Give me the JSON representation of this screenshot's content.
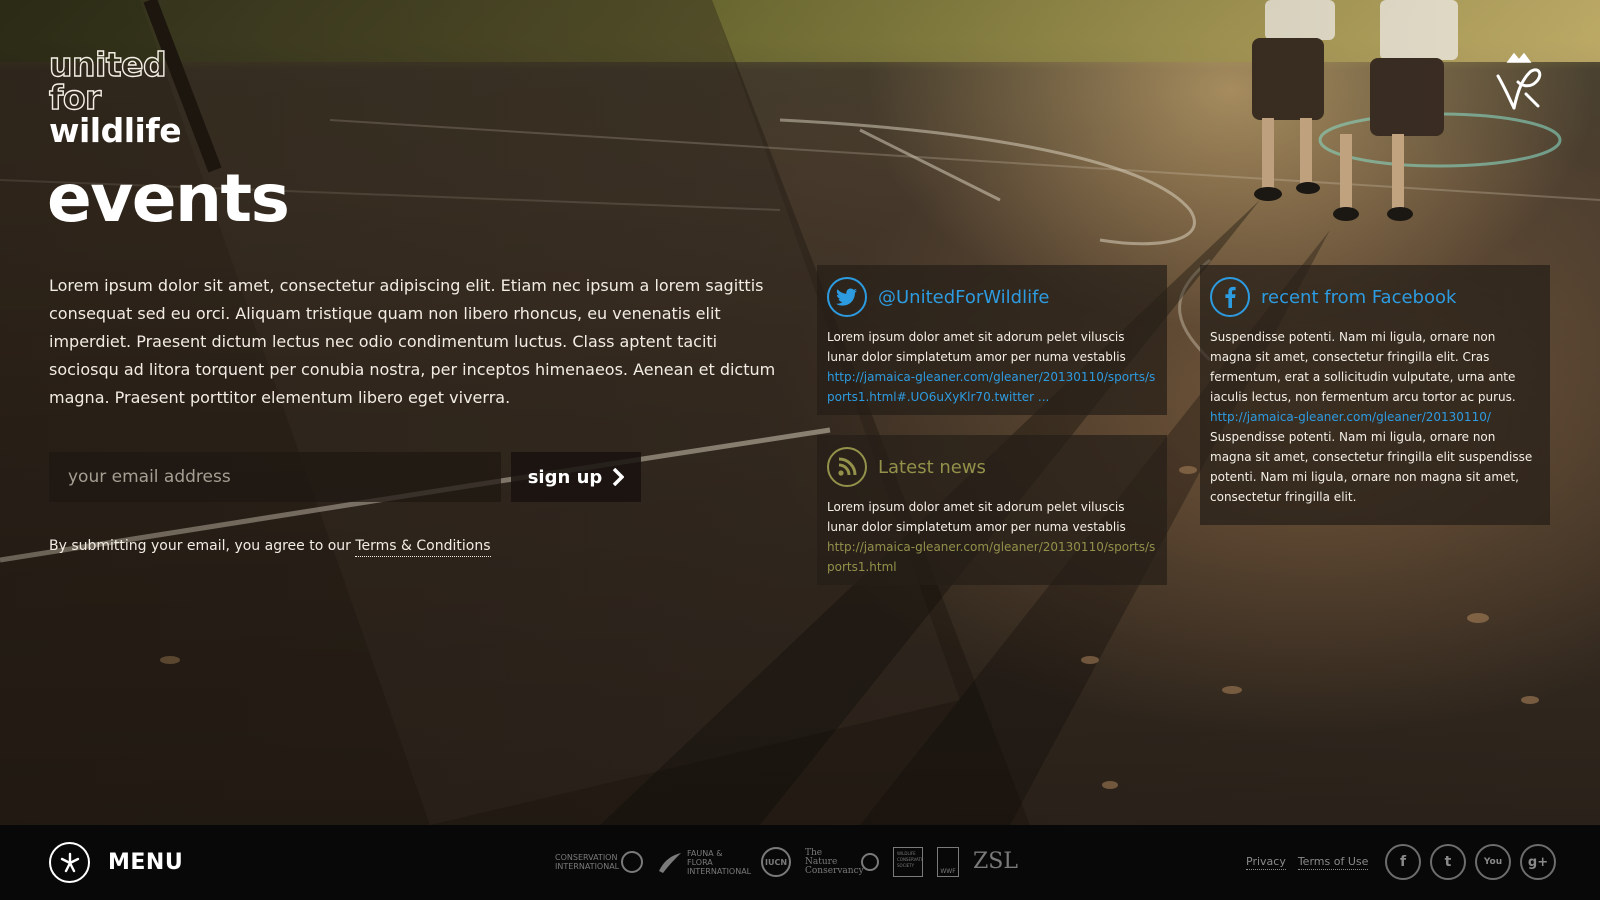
{
  "brand": {
    "line1": "united",
    "line2": "for",
    "line3": "wildlife"
  },
  "page": {
    "title": "events",
    "intro": "Lorem ipsum dolor sit amet, consectetur adipiscing elit. Etiam nec ipsum a lorem sagittis consequat sed eu orci. Aliquam tristique quam non libero rhoncus, eu venenatis elit imperdiet. Praesent dictum lectus nec odio condimentum luctus. Class aptent taciti sociosqu ad litora torquent per conubia nostra, per inceptos himenaeos. Aenean et dictum magna. Praesent porttitor elementum libero eget viverra."
  },
  "signup": {
    "placeholder": "your email address",
    "button_label": "sign up",
    "terms_prefix": "By submitting your email, you agree to our",
    "terms_link": "Terms & Conditions"
  },
  "twitter": {
    "title": "@UnitedForWildlife",
    "body": "Lorem ipsum dolor amet sit adorum pelet viluscis lunar dolor simplatetum amor per numa vestablis",
    "link": "http://jamaica-gleaner.com/gleaner/20130110/sports/sports1.html#.UO6uXyKlr70.twitter ..."
  },
  "news": {
    "title": "Latest news",
    "body": "Lorem ipsum dolor amet sit adorum pelet viluscis lunar dolor simplatetum amor per numa vestablis",
    "link": "http://jamaica-gleaner.com/gleaner/20130110/sports/sports1.html"
  },
  "facebook": {
    "title": "recent from Facebook",
    "body1": "Suspendisse potenti. Nam mi ligula, ornare non magna sit amet, consectetur fringilla elit. Cras fermentum, erat a sollicitudin vulputate, urna ante iaculis lectus, non fermentum arcu tortor ac purus.",
    "link": "http://jamaica-gleaner.com/gleaner/20130110/",
    "body2": "Suspendisse potenti. Nam mi ligula, ornare non magna sit amet, consectetur fringilla elit suspendisse potenti. Nam mi ligula, ornare non magna sit amet, consectetur fringilla elit."
  },
  "footer": {
    "menu_label": "MENU",
    "partners": {
      "ci": "CONSERVATION INTERNATIONAL",
      "ff": "FAUNA & FLORA INTERNATIONAL",
      "iucn": "IUCN",
      "tnc": "The Nature Conservancy",
      "wcs": "WILDLIFE CONSERVATION SOCIETY",
      "wwf": "WWF",
      "zsl": "ZSL"
    },
    "privacy": "Privacy",
    "terms_of_use": "Terms of Use",
    "social": {
      "facebook": "f",
      "twitter": "t",
      "youtube": "You",
      "googleplus": "g+"
    }
  },
  "colors": {
    "accent_blue": "#2d9be0",
    "accent_olive": "#93914a",
    "footer_bg": "#080808"
  },
  "icons": [
    "twitter-icon",
    "rss-icon",
    "facebook-icon",
    "menu-swallow-icon",
    "crest-icon"
  ]
}
